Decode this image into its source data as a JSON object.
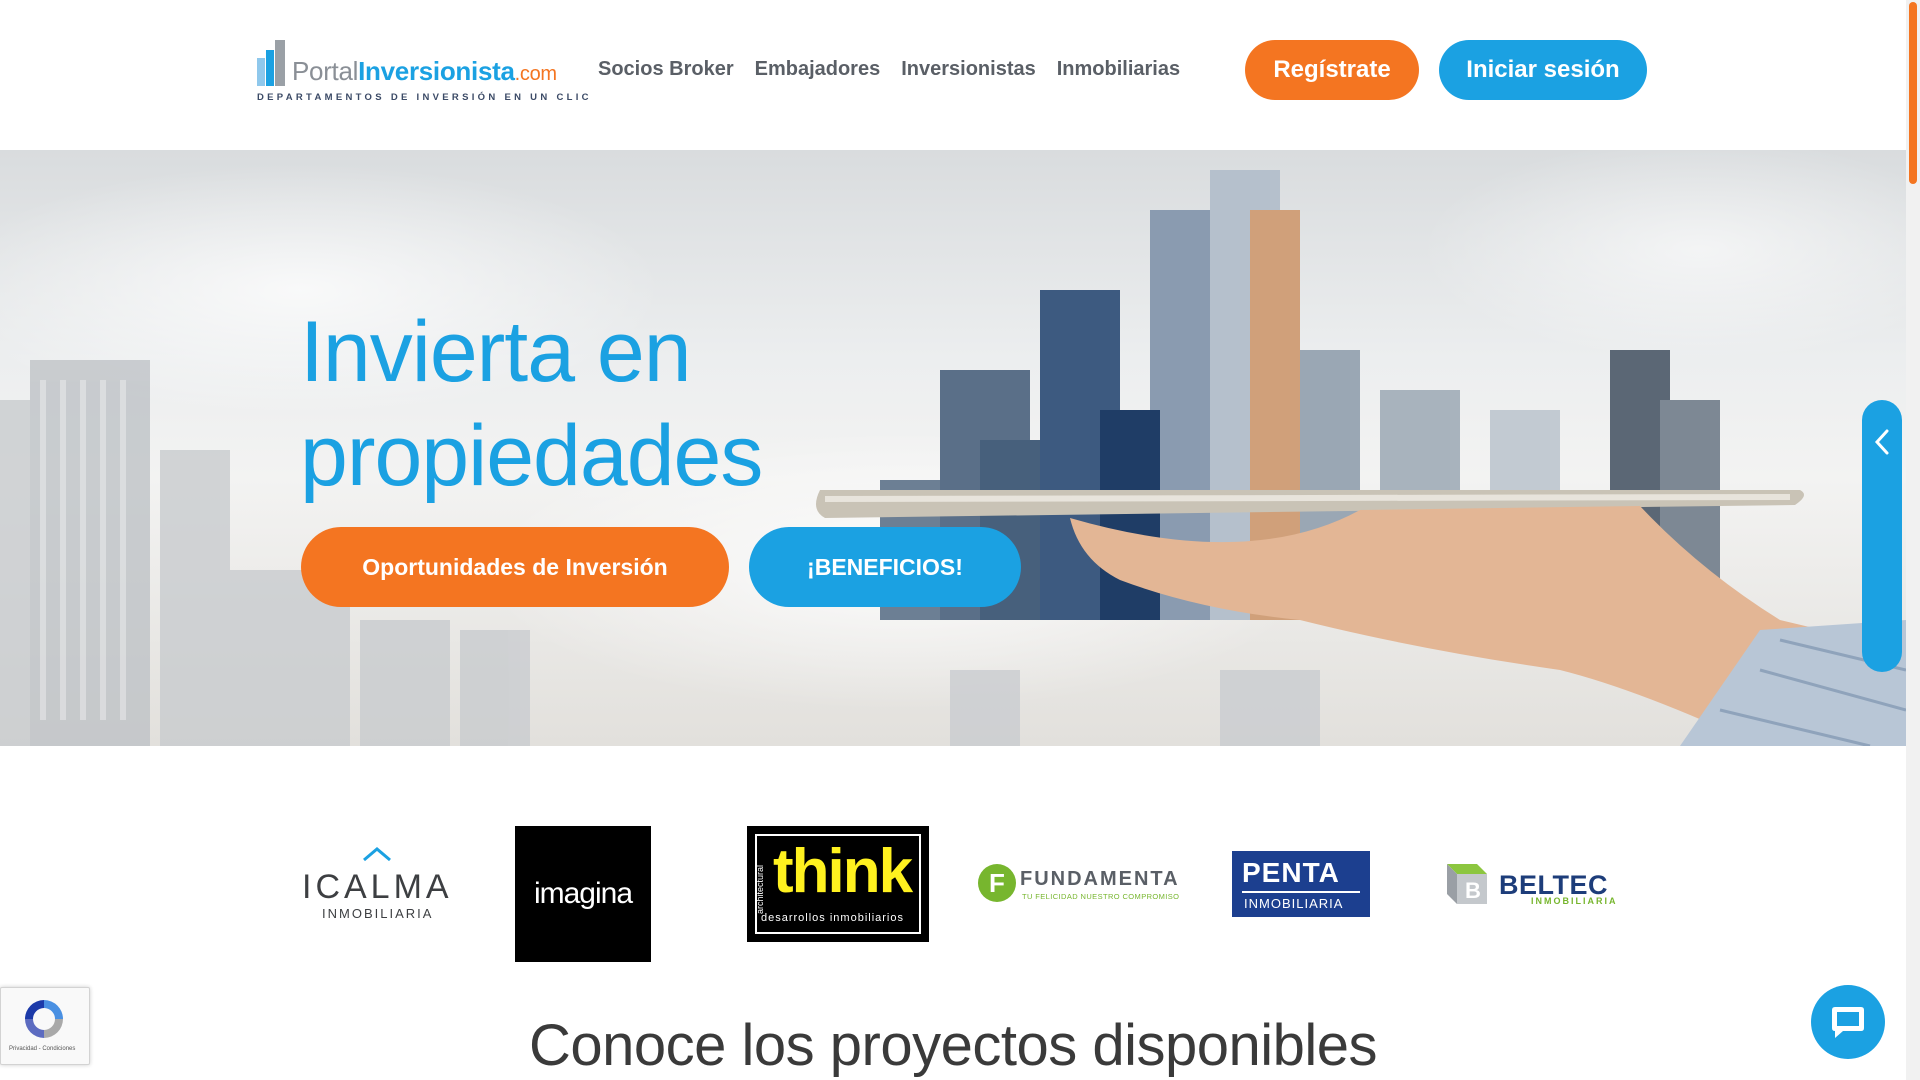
{
  "header": {
    "logo": {
      "word_plain": "Portal",
      "word_strong": "Inversionista",
      "word_tld": ".com",
      "tagline": "DEPARTAMENTOS DE INVERSIÓN EN UN CLIC"
    },
    "nav": [
      {
        "label": "Socios Broker"
      },
      {
        "label": "Embajadores"
      },
      {
        "label": "Inversionistas"
      },
      {
        "label": "Inmobiliarias"
      }
    ],
    "register_label": "Regístrate",
    "login_label": "Iniciar sesión"
  },
  "hero": {
    "title_line1": "Invierta en",
    "title_line2": "propiedades",
    "btn_opportunities": "Oportunidades de Inversión",
    "btn_benefits": "¡BENEFICIOS!"
  },
  "partners": {
    "icalma": {
      "word": "ICALMA",
      "sub": "INMOBILIARIA"
    },
    "imagina": {
      "word": "imagina"
    },
    "think": {
      "word": "think",
      "arch": "architectural",
      "sub": "desarrollos inmobiliarios"
    },
    "fundamenta": {
      "word": "FUNDAMENTA",
      "sub": "TU FELICIDAD NUESTRO COMPROMISO"
    },
    "penta": {
      "word": "PENTA",
      "sub": "INMOBILIARIA"
    },
    "beltec": {
      "word": "BELTEC",
      "sub": "INMOBILIARIA"
    }
  },
  "section": {
    "title": "Conoce los proyectos disponibles"
  },
  "recaptcha": {
    "text": "Privacidad - Condiciones"
  },
  "icons": {
    "side_tab": "chevron-left-icon",
    "chat": "chat-bubble-icon",
    "recaptcha": "recaptcha-icon"
  },
  "colors": {
    "orange": "#f47521",
    "blue": "#1ba1e2",
    "navy": "#1c3f8f",
    "green": "#77b62e"
  }
}
